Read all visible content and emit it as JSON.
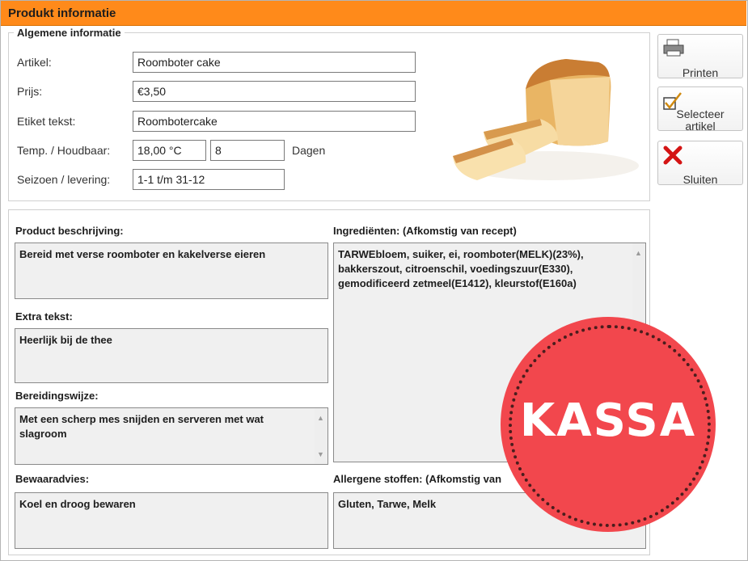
{
  "window": {
    "title": "Produkt informatie"
  },
  "general": {
    "legend": "Algemene informatie",
    "artikel_label": "Artikel:",
    "artikel_value": "Roomboter cake",
    "prijs_label": "Prijs:",
    "prijs_value": "€3,50",
    "etiket_label": "Etiket tekst:",
    "etiket_value": "Roombotercake",
    "temp_label": "Temp. / Houdbaar:",
    "temp_value": "18,00 °C",
    "houdbaar_value": "8",
    "dagen_label": "Dagen",
    "seizoen_label": "Seizoen / levering:",
    "seizoen_value": "1-1 t/m 31-12"
  },
  "buttons": {
    "print_label": "Printen",
    "select_line1": "Selecteer",
    "select_line2": "artikel",
    "close_label": "Sluiten",
    "print_icon": "printer-icon",
    "select_icon": "checkbox-check-icon",
    "close_icon": "red-x-icon"
  },
  "details": {
    "beschrijving_label": "Product beschrijving:",
    "beschrijving_value": "Bereid met verse roomboter en kakelverse eieren",
    "extra_label": "Extra tekst:",
    "extra_value": "Heerlijk bij de thee",
    "bereiding_label": "Bereidingswijze:",
    "bereiding_value": "Met een scherp mes snijden en serveren met wat slagroom",
    "bewaar_label": "Bewaaradvies:",
    "bewaar_value": "Koel en droog bewaren",
    "ingredienten_label": "Ingrediënten: (Afkomstig van recept)",
    "ingredienten_value": "TARWEbloem, suiker, ei, roomboter(MELK)(23%), bakkerszout, citroenschil, voedingszuur(E330), gemodificeerd zetmeel(E1412), kleurstof(E160a)",
    "allergenen_label": "Allergene stoffen: (Afkomstig van",
    "allergenen_value": "Gluten, Tarwe, Melk"
  },
  "badge": {
    "text": "KASSA",
    "color": "#f2474d"
  },
  "colors": {
    "titlebar": "#ff8a1a"
  }
}
